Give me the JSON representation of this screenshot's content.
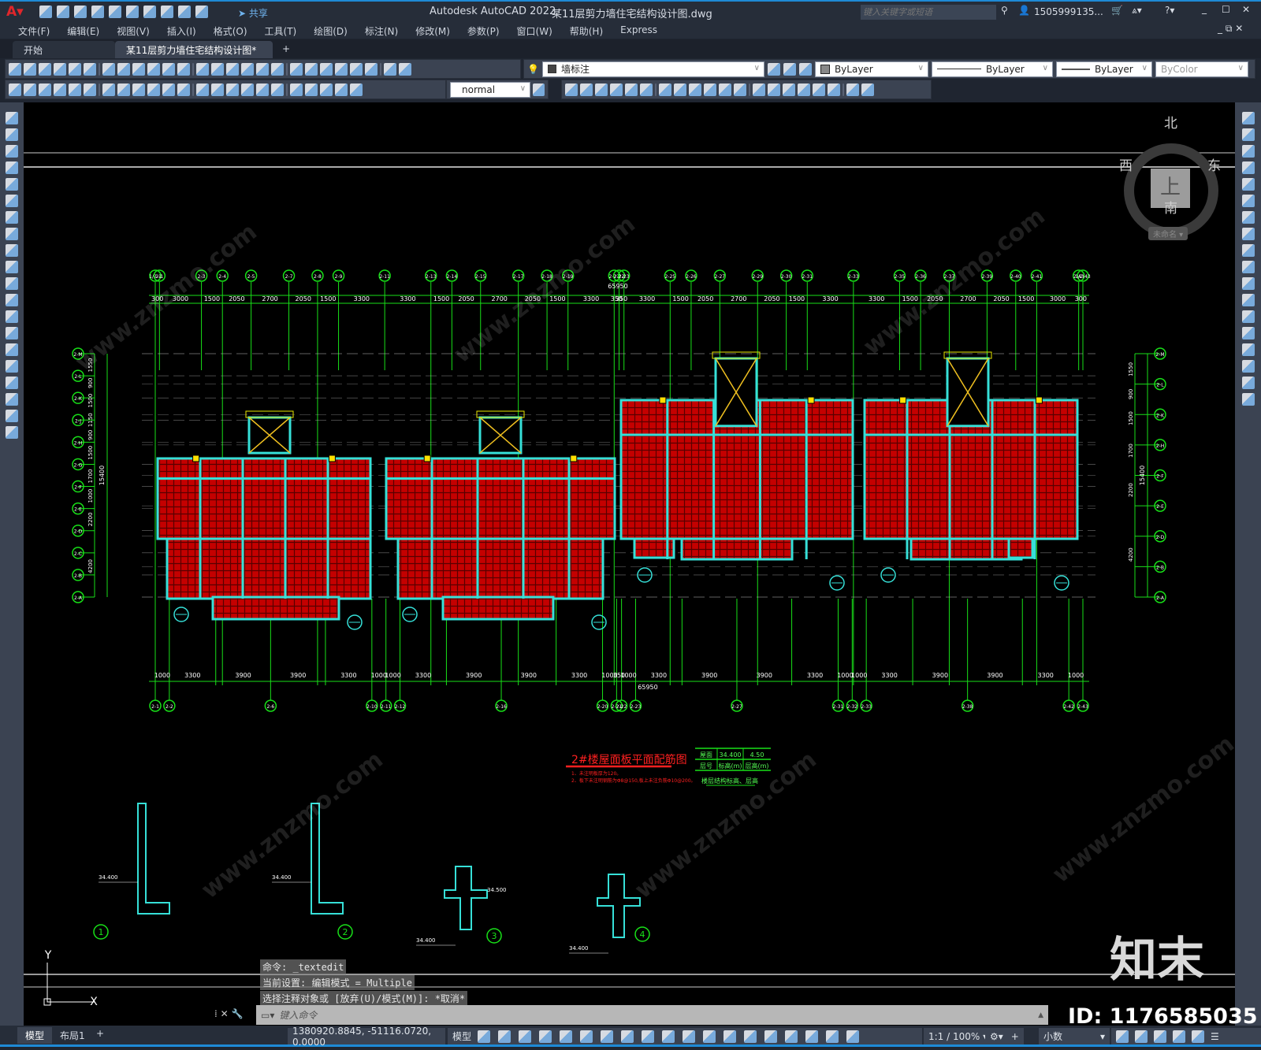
{
  "app": {
    "title": "Autodesk AutoCAD 2022",
    "filename": "某11层剪力墙住宅结构设计图.dwg",
    "share": "共享",
    "search_placeholder": "键入关键字或短语",
    "user": "1505999135...",
    "accent": "#1e8ad6"
  },
  "menu": [
    "文件(F)",
    "编辑(E)",
    "视图(V)",
    "插入(I)",
    "格式(O)",
    "工具(T)",
    "绘图(D)",
    "标注(N)",
    "修改(M)",
    "参数(P)",
    "窗口(W)",
    "帮助(H)",
    "Express"
  ],
  "tabs": [
    {
      "label": "开始",
      "active": false
    },
    {
      "label": "某11层剪力墙住宅结构设计图*",
      "active": true
    }
  ],
  "toolbar1": {
    "icons": [
      "new-icon",
      "open-icon",
      "save-icon",
      "print-icon",
      "print-preview-icon",
      "plot-icon",
      "publish-icon",
      "cut-icon",
      "copy-icon",
      "paste-icon",
      "match-properties-icon",
      "block-editor-icon",
      "undo-icon",
      "redo-icon",
      "pan-icon",
      "zoom-realtime-icon",
      "zoom-window-icon",
      "zoom-previous-icon",
      "properties-icon",
      "design-center-icon",
      "tool-palettes-icon",
      "sheet-set-icon",
      "markup-icon",
      "quickcalc-icon",
      "help-icon",
      "layer-properties-icon"
    ],
    "layer": "墙标注",
    "color": "ByLayer",
    "linetype": "ByLayer",
    "lineweight": "ByLayer",
    "plotstyle": "ByColor"
  },
  "toolbar2": {
    "icons": [
      "block-icon",
      "check-icon",
      "erase-text-icon",
      "linear-dim-icon",
      "aligned-dim-icon",
      "arc-length-icon",
      "ordinate-icon",
      "radius-icon",
      "jogged-icon",
      "diameter-icon",
      "angular-icon",
      "quick-dim-icon",
      "baseline-icon",
      "continue-icon",
      "dim-space-icon",
      "dim-break-icon",
      "tolerance-icon",
      "center-mark-icon",
      "inspection-icon",
      "jogged-linear-icon",
      "dim-edit-icon",
      "dim-text-edit-icon",
      "dim-update-icon"
    ],
    "dimstyle": "normal",
    "icons_right": [
      "box-icon",
      "wedge-icon",
      "cone-icon",
      "union-icon",
      "subtract-icon",
      "intersect-icon",
      "extrude-icon",
      "revolve-icon",
      "slice-icon",
      "section-icon",
      "interfere-icon",
      "3dalign-icon",
      "3dmove-icon",
      "3drotate-icon",
      "presspull-icon",
      "shell-icon",
      "separate-icon",
      "imprint-icon",
      "clean-icon",
      "check-solid-icon"
    ]
  },
  "leftbar_icons": [
    "line-icon",
    "construction-line-icon",
    "polyline-icon",
    "polygon-icon",
    "rectangle-icon",
    "arc-icon",
    "circle-icon",
    "revcloud-icon",
    "spline-icon",
    "ellipse-icon",
    "ellipse-arc-icon",
    "insert-block-icon",
    "make-block-icon",
    "point-icon",
    "hatch-icon",
    "gradient-icon",
    "region-icon",
    "table-icon",
    "mtext-icon",
    "add-selected-icon"
  ],
  "rightbar_icons": [
    "erase-icon",
    "copy-icon",
    "mirror-icon",
    "offset-icon",
    "array-icon",
    "move-icon",
    "rotate-icon",
    "scale-icon",
    "stretch-icon",
    "trim-icon",
    "extend-icon",
    "break-point-icon",
    "break-icon",
    "join-icon",
    "chamfer-icon",
    "fillet-icon",
    "blend-icon",
    "explode-icon"
  ],
  "viewcube": {
    "north": "北",
    "south": "南",
    "east": "东",
    "west": "西",
    "face": "上",
    "ucs": "未命名"
  },
  "drawing": {
    "top_total": "65950",
    "top_dims": [
      "300",
      "3000",
      "1500",
      "2050",
      "2700",
      "2050",
      "1500",
      "3300",
      "3300",
      "1500",
      "2050",
      "2700",
      "2050",
      "1500",
      "3300",
      "350",
      "350",
      "3300",
      "1500",
      "2050",
      "2700",
      "2050",
      "1500",
      "3300",
      "3300",
      "1500",
      "2050",
      "2700",
      "2050",
      "1500",
      "3000",
      "300"
    ],
    "top_axes": [
      "1/2-1",
      "2-1",
      "2-3",
      "2-4",
      "2-5",
      "2-7",
      "2-8",
      "2-9",
      "2-11",
      "2-13",
      "2-14",
      "2-15",
      "2-17",
      "2-18",
      "2-19",
      "2-21",
      "2-22",
      "2-23",
      "2-25",
      "2-26",
      "2-27",
      "2-29",
      "2-30",
      "2-31",
      "2-33",
      "2-35",
      "2-36",
      "2-37",
      "2-39",
      "2-40",
      "2-41",
      "2-43",
      "1/2-43"
    ],
    "bottom_total": "65950",
    "bottom_dims": [
      "1000",
      "3300",
      "3900",
      "3900",
      "3300",
      "1000",
      "1000",
      "3300",
      "3900",
      "3900",
      "3300",
      "1000",
      "350",
      "1000",
      "3300",
      "3900",
      "3900",
      "3300",
      "1000",
      "1000",
      "3300",
      "3900",
      "3900",
      "3300",
      "1000"
    ],
    "bottom_axes": [
      "2-1",
      "2-2",
      "",
      "2-6",
      "",
      "2-10",
      "2-11",
      "2-12",
      "",
      "2-16",
      "",
      "2-20",
      "2-21",
      "2-22",
      "2-23",
      "",
      "2-27",
      "",
      "2-31",
      "2-32",
      "2-33",
      "",
      "2-38",
      "",
      "2-42",
      "2-43"
    ],
    "left_dims": [
      "1550",
      "900",
      "1500",
      "1150",
      "900",
      "1500",
      "1700",
      "1000",
      "2200",
      "4200"
    ],
    "left_total": "15400",
    "left_axes": [
      "2-M",
      "2-L",
      "2-K",
      "2-J",
      "2-H",
      "2-G",
      "2-F",
      "2-E",
      "2-D",
      "2-C",
      "2-B",
      "2-A"
    ],
    "right_dims": [
      "1550",
      "900",
      "1500",
      "1700",
      "2200",
      "4200"
    ],
    "right_total": "15400",
    "right_axes": [
      "2-M",
      "2-L",
      "2-K",
      "2-H",
      "2-F",
      "2-E",
      "2-D",
      "2-B",
      "2-A"
    ],
    "plan_title": "2#楼屋面板平面配筋图",
    "notes": [
      "1、未注明板厚为120。",
      "2、板下未注明钢筋为Φ8@150,板上未注负筋Φ10@200。"
    ],
    "level_table": {
      "rows": [
        [
          "屋面",
          "34.400",
          "4.50"
        ],
        [
          "层号",
          "标高(m)",
          "层高(m)"
        ]
      ],
      "caption": "楼层结构标高、层高"
    },
    "details": [
      {
        "num": "1",
        "elev": "34.400"
      },
      {
        "num": "2",
        "elev": "34.400"
      },
      {
        "num": "3",
        "elev": "34.400",
        "elev2": "34.500"
      },
      {
        "num": "4",
        "elev": "34.400"
      }
    ],
    "ucs": {
      "x": "X",
      "y": "Y"
    }
  },
  "command": {
    "history": [
      "命令: _textedit",
      "当前设置: 编辑模式 = Multiple",
      "选择注释对象或 [放弃(U)/模式(M)]: *取消*"
    ],
    "placeholder": "键入命令"
  },
  "layout_tabs": [
    "模型",
    "布局1"
  ],
  "status": {
    "coords": "1380920.8845, -51116.0720, 0.0000",
    "space": "模型",
    "scale": "1:1 / 100%",
    "units": "小数"
  },
  "watermark": {
    "site": "www.znzmo.com",
    "logo": "知末",
    "id": "ID: 1176585035"
  }
}
